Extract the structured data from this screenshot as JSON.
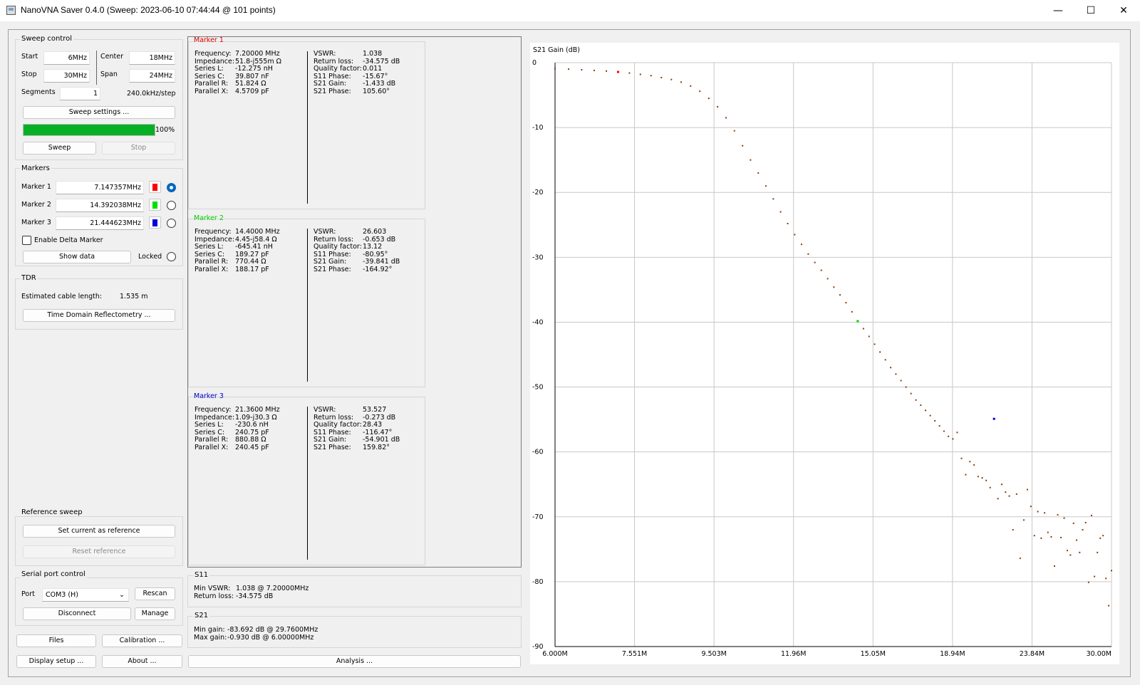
{
  "window": {
    "title": "NanoVNA Saver 0.4.0 (Sweep: 2023-06-10 07:44:44 @ 101 points)",
    "minimize": "—",
    "maximize": "☐",
    "close": "✕"
  },
  "sweep_control": {
    "title": "Sweep control",
    "start_label": "Start",
    "start_value": "6MHz",
    "center_label": "Center",
    "center_value": "18MHz",
    "stop_label": "Stop",
    "stop_value": "30MHz",
    "span_label": "Span",
    "span_value": "24MHz",
    "segments_label": "Segments",
    "segments_value": "1",
    "step_text": "240.0kHz/step",
    "settings_button": "Sweep settings ...",
    "progress_percent": 100,
    "progress_text": "100%",
    "sweep_button": "Sweep",
    "stop_button": "Stop"
  },
  "markers": {
    "title": "Markers",
    "items": [
      {
        "label": "Marker 1",
        "value": "7.147357MHz",
        "color": "#ff0000",
        "selected": true
      },
      {
        "label": "Marker 2",
        "value": "14.392038MHz",
        "color": "#00e000",
        "selected": false
      },
      {
        "label": "Marker 3",
        "value": "21.444623MHz",
        "color": "#0000e0",
        "selected": false
      }
    ],
    "delta_label": "Enable Delta Marker",
    "show_data_button": "Show data",
    "locked_label": "Locked"
  },
  "tdr": {
    "title": "TDR",
    "cable_label": "Estimated cable length:",
    "cable_value": "1.535 m",
    "button": "Time Domain Reflectometry ..."
  },
  "reference_sweep": {
    "title": "Reference sweep",
    "set_button": "Set current as reference",
    "reset_button": "Reset reference"
  },
  "serial": {
    "title": "Serial port control",
    "port_label": "Port",
    "port_value": "COM3 (H)",
    "rescan_button": "Rescan",
    "disconnect_button": "Disconnect",
    "manage_button": "Manage"
  },
  "bottom_buttons": {
    "files": "Files",
    "calibration": "Calibration ...",
    "display_setup": "Display setup ...",
    "about": "About ...",
    "analysis": "Analysis ..."
  },
  "marker_panels": [
    {
      "title": "Marker 1",
      "color": "#ff0000",
      "left": [
        [
          "Frequency:",
          "7.20000 MHz"
        ],
        [
          "Impedance:",
          "51.8-j555m Ω"
        ],
        [
          "Series L:",
          "-12.275 nH"
        ],
        [
          "Series C:",
          "39.807 nF"
        ],
        [
          "Parallel R:",
          "51.824 Ω"
        ],
        [
          "Parallel X:",
          "4.5709 pF"
        ]
      ],
      "right": [
        [
          "VSWR:",
          "1.038"
        ],
        [
          "Return loss:",
          "-34.575 dB"
        ],
        [
          "Quality factor:",
          "0.011"
        ],
        [
          "S11 Phase:",
          "-15.67°"
        ],
        [
          "S21 Gain:",
          "-1.433 dB"
        ],
        [
          "S21 Phase:",
          "105.60°"
        ]
      ]
    },
    {
      "title": "Marker 2",
      "color": "#00cc00",
      "left": [
        [
          "Frequency:",
          "14.4000 MHz"
        ],
        [
          "Impedance:",
          "4.45-j58.4 Ω"
        ],
        [
          "Series L:",
          "-645.41 nH"
        ],
        [
          "Series C:",
          "189.27 pF"
        ],
        [
          "Parallel R:",
          "770.44 Ω"
        ],
        [
          "Parallel X:",
          "188.17 pF"
        ]
      ],
      "right": [
        [
          "VSWR:",
          "26.603"
        ],
        [
          "Return loss:",
          "-0.653 dB"
        ],
        [
          "Quality factor:",
          "13.12"
        ],
        [
          "S11 Phase:",
          "-80.95°"
        ],
        [
          "S21 Gain:",
          "-39.841 dB"
        ],
        [
          "S21 Phase:",
          "-164.92°"
        ]
      ]
    },
    {
      "title": "Marker 3",
      "color": "#0000cc",
      "left": [
        [
          "Frequency:",
          "21.3600 MHz"
        ],
        [
          "Impedance:",
          "1.09-j30.3 Ω"
        ],
        [
          "Series L:",
          "-230.6 nH"
        ],
        [
          "Series C:",
          "240.75 pF"
        ],
        [
          "Parallel R:",
          "880.88 Ω"
        ],
        [
          "Parallel X:",
          "240.45 pF"
        ]
      ],
      "right": [
        [
          "VSWR:",
          "53.527"
        ],
        [
          "Return loss:",
          "-0.273 dB"
        ],
        [
          "Quality factor:",
          "28.43"
        ],
        [
          "S11 Phase:",
          "-116.47°"
        ],
        [
          "S21 Gain:",
          "-54.901 dB"
        ],
        [
          "S21 Phase:",
          "159.82°"
        ]
      ]
    }
  ],
  "s11_summary": {
    "title": "S11",
    "min_vswr_label": "Min VSWR:",
    "min_vswr_value": "1.038 @ 7.20000MHz",
    "return_loss_label": "Return loss:",
    "return_loss_value": "-34.575 dB"
  },
  "s21_summary": {
    "title": "S21",
    "min_gain_label": "Min gain:",
    "min_gain_value": "-83.692 dB @ 29.7600MHz",
    "max_gain_label": "Max gain:",
    "max_gain_value": "-0.930 dB @ 6.00000MHz"
  },
  "chart_data": {
    "type": "scatter",
    "title": "S21 Gain (dB)",
    "x_unit": "MHz",
    "xlim": [
      6.0,
      30.0
    ],
    "ylim": [
      -90,
      0
    ],
    "x_tick_labels": [
      "6.000M",
      "7.551M",
      "9.503M",
      "11.96M",
      "15.05M",
      "18.94M",
      "23.84M",
      "30.00M"
    ],
    "y_ticks": [
      0,
      -10,
      -20,
      -30,
      -40,
      -50,
      -60,
      -70,
      -80,
      -90
    ],
    "grid": true,
    "point_color": "#8b3a00",
    "markers": [
      {
        "x": 7.2,
        "y": -1.433,
        "color": "#ff0000"
      },
      {
        "x": 14.4,
        "y": -39.841,
        "color": "#00cc00"
      },
      {
        "x": 21.36,
        "y": -54.901,
        "color": "#0000cc"
      }
    ],
    "series": [
      {
        "x": [
          6.0,
          6.24,
          6.48,
          6.72,
          6.96,
          7.2,
          7.44,
          7.68,
          7.92,
          8.16,
          8.4,
          8.64,
          8.88,
          9.12,
          9.36,
          9.6,
          9.84,
          10.08,
          10.32,
          10.56,
          10.8,
          11.04,
          11.28,
          11.52,
          11.76,
          12.0,
          12.24,
          12.48,
          12.72,
          12.96,
          13.2,
          13.44,
          13.68,
          13.92,
          14.16,
          14.4,
          14.64,
          14.88,
          15.12,
          15.36,
          15.6,
          15.84,
          16.08,
          16.32,
          16.56,
          16.8,
          17.04,
          17.28,
          17.52,
          17.76,
          18.0,
          18.24,
          18.48,
          18.72,
          18.96,
          19.2,
          19.44,
          19.68,
          19.92,
          20.16,
          20.4,
          20.64,
          20.88,
          21.12,
          21.36,
          21.6,
          21.84,
          22.08,
          22.32,
          22.56,
          22.8,
          23.04,
          23.28,
          23.52,
          23.76,
          24.0,
          24.24,
          24.48,
          24.72,
          24.96,
          25.2,
          25.44,
          25.68,
          25.92,
          26.16,
          26.4,
          26.64,
          26.88,
          27.12,
          27.36,
          27.6,
          27.84,
          28.08,
          28.32,
          28.56,
          28.8,
          29.04,
          29.28,
          29.52,
          29.76,
          30.0
        ],
        "y": [
          -0.93,
          -1.0,
          -1.1,
          -1.2,
          -1.3,
          -1.43,
          -1.6,
          -1.8,
          -2.0,
          -2.3,
          -2.6,
          -3.0,
          -3.6,
          -4.4,
          -5.5,
          -6.8,
          -8.5,
          -10.5,
          -12.8,
          -15.0,
          -17.0,
          -19.0,
          -21.0,
          -23.0,
          -24.8,
          -26.5,
          -28.0,
          -29.5,
          -30.8,
          -32.0,
          -33.3,
          -34.6,
          -35.8,
          -37.0,
          -38.4,
          -39.8,
          -41.0,
          -42.2,
          -43.4,
          -44.6,
          -45.8,
          -47.0,
          -48.0,
          -49.0,
          -50.0,
          -51.0,
          -52.0,
          -52.8,
          -53.6,
          -54.4,
          -55.2,
          -56.0,
          -56.8,
          -57.6,
          -58.0,
          -57.0,
          -61.0,
          -63.5,
          -61.5,
          -62.0,
          -63.8,
          -64.0,
          -64.4,
          -65.5,
          -54.9,
          -67.2,
          -65.0,
          -66.2,
          -66.8,
          -72.0,
          -66.5,
          -76.4,
          -70.5,
          -65.8,
          -68.4,
          -72.9,
          -69.2,
          -73.3,
          -69.4,
          -72.4,
          -73.1,
          -77.6,
          -69.7,
          -73.2,
          -70.2,
          -75.2,
          -75.9,
          -71.0,
          -73.6,
          -75.5,
          -72.0,
          -70.9,
          -80.1,
          -69.8,
          -79.2,
          -75.5,
          -73.3,
          -72.9,
          -79.5,
          -83.7,
          -78.3
        ]
      }
    ]
  }
}
